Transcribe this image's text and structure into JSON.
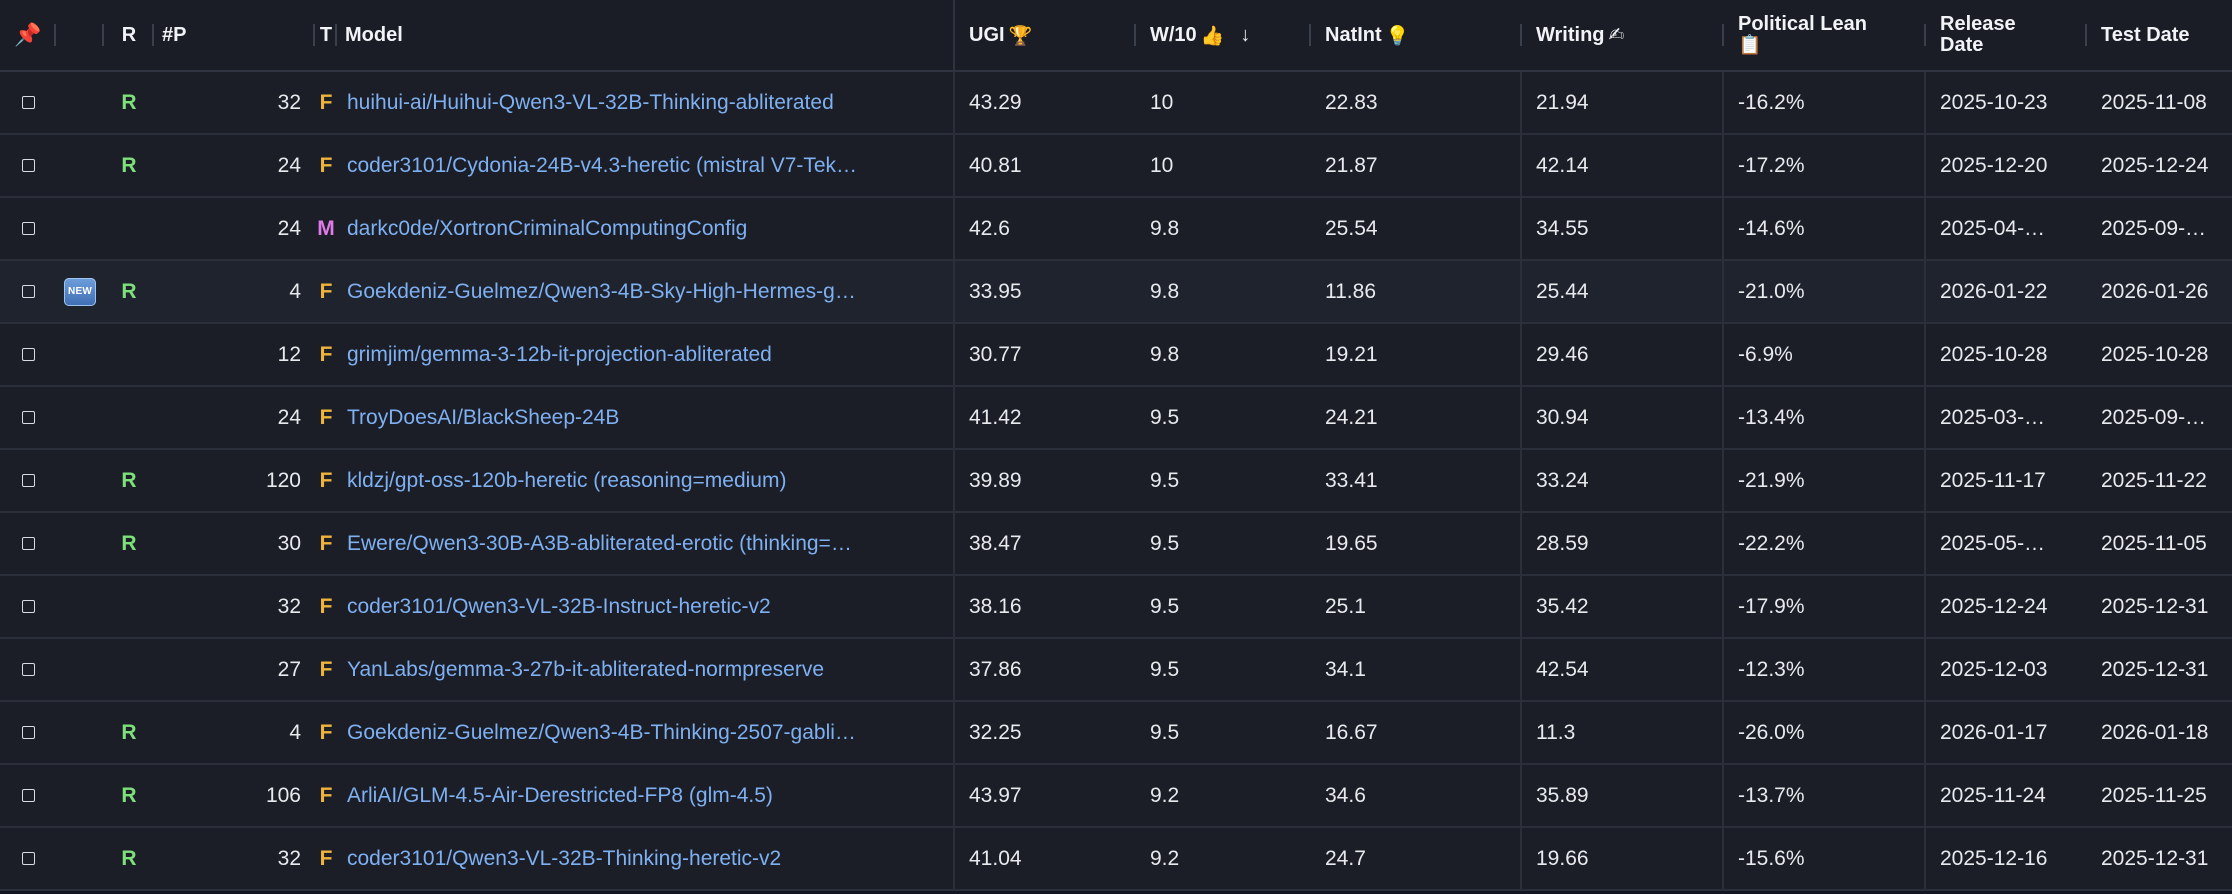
{
  "header": {
    "pin_icon": "pushpin-icon",
    "r": "R",
    "params": "#P",
    "type": "T",
    "model": "Model",
    "ugi": "UGI",
    "ugi_icon": "🏆",
    "w10": "W/10",
    "w10_icon": "👍",
    "w10_sort": "↓",
    "natint": "NatInt",
    "natint_icon": "💡",
    "writing": "Writing",
    "writing_icon": "✍",
    "political_line1": "Political Lean",
    "political_icon": "📋",
    "release_line1": "Release",
    "release_line2": "Date",
    "test_date": "Test Date"
  },
  "colors": {
    "background": "#131620",
    "row": "#1b1e27",
    "link": "#7eb0f2",
    "r_badge": "#7ee07a",
    "type_F": "#f0b43a",
    "type_M": "#e07ae8",
    "pin": "#e64848"
  },
  "rows": [
    {
      "new": "",
      "r": "R",
      "params": "32",
      "type": "F",
      "model": "huihui-ai/Huihui-Qwen3-VL-32B-Thinking-abliterated",
      "ugi": "43.29",
      "w10": "10",
      "natint": "22.83",
      "writing": "21.94",
      "political": "-16.2%",
      "release": "2025-10-23",
      "test": "2025-11-08"
    },
    {
      "new": "",
      "r": "R",
      "params": "24",
      "type": "F",
      "model": "coder3101/Cydonia-24B-v4.3-heretic (mistral V7-Tek…",
      "ugi": "40.81",
      "w10": "10",
      "natint": "21.87",
      "writing": "42.14",
      "political": "-17.2%",
      "release": "2025-12-20",
      "test": "2025-12-24"
    },
    {
      "new": "",
      "r": "",
      "params": "24",
      "type": "M",
      "model": "darkc0de/XortronCriminalComputingConfig",
      "ugi": "42.6",
      "w10": "9.8",
      "natint": "25.54",
      "writing": "34.55",
      "political": "-14.6%",
      "release": "2025-04-…",
      "test": "2025-09-…"
    },
    {
      "new": "NEW",
      "r": "R",
      "params": "4",
      "type": "F",
      "model": "Goekdeniz-Guelmez/Qwen3-4B-Sky-High-Hermes-g…",
      "ugi": "33.95",
      "w10": "9.8",
      "natint": "11.86",
      "writing": "25.44",
      "political": "-21.0%",
      "release": "2026-01-22",
      "test": "2026-01-26"
    },
    {
      "new": "",
      "r": "",
      "params": "12",
      "type": "F",
      "model": "grimjim/gemma-3-12b-it-projection-abliterated",
      "ugi": "30.77",
      "w10": "9.8",
      "natint": "19.21",
      "writing": "29.46",
      "political": "-6.9%",
      "release": "2025-10-28",
      "test": "2025-10-28"
    },
    {
      "new": "",
      "r": "",
      "params": "24",
      "type": "F",
      "model": "TroyDoesAI/BlackSheep-24B",
      "ugi": "41.42",
      "w10": "9.5",
      "natint": "24.21",
      "writing": "30.94",
      "political": "-13.4%",
      "release": "2025-03-…",
      "test": "2025-09-…"
    },
    {
      "new": "",
      "r": "R",
      "params": "120",
      "type": "F",
      "model": "kldzj/gpt-oss-120b-heretic (reasoning=medium)",
      "ugi": "39.89",
      "w10": "9.5",
      "natint": "33.41",
      "writing": "33.24",
      "political": "-21.9%",
      "release": "2025-11-17",
      "test": "2025-11-22"
    },
    {
      "new": "",
      "r": "R",
      "params": "30",
      "type": "F",
      "model": "Ewere/Qwen3-30B-A3B-abliterated-erotic (thinking=…",
      "ugi": "38.47",
      "w10": "9.5",
      "natint": "19.65",
      "writing": "28.59",
      "political": "-22.2%",
      "release": "2025-05-…",
      "test": "2025-11-05"
    },
    {
      "new": "",
      "r": "",
      "params": "32",
      "type": "F",
      "model": "coder3101/Qwen3-VL-32B-Instruct-heretic-v2",
      "ugi": "38.16",
      "w10": "9.5",
      "natint": "25.1",
      "writing": "35.42",
      "political": "-17.9%",
      "release": "2025-12-24",
      "test": "2025-12-31"
    },
    {
      "new": "",
      "r": "",
      "params": "27",
      "type": "F",
      "model": "YanLabs/gemma-3-27b-it-abliterated-normpreserve",
      "ugi": "37.86",
      "w10": "9.5",
      "natint": "34.1",
      "writing": "42.54",
      "political": "-12.3%",
      "release": "2025-12-03",
      "test": "2025-12-31"
    },
    {
      "new": "",
      "r": "R",
      "params": "4",
      "type": "F",
      "model": "Goekdeniz-Guelmez/Qwen3-4B-Thinking-2507-gabli…",
      "ugi": "32.25",
      "w10": "9.5",
      "natint": "16.67",
      "writing": "11.3",
      "political": "-26.0%",
      "release": "2026-01-17",
      "test": "2026-01-18"
    },
    {
      "new": "",
      "r": "R",
      "params": "106",
      "type": "F",
      "model": "ArliAI/GLM-4.5-Air-Derestricted-FP8 (glm-4.5)",
      "ugi": "43.97",
      "w10": "9.2",
      "natint": "34.6",
      "writing": "35.89",
      "political": "-13.7%",
      "release": "2025-11-24",
      "test": "2025-11-25"
    },
    {
      "new": "",
      "r": "R",
      "params": "32",
      "type": "F",
      "model": "coder3101/Qwen3-VL-32B-Thinking-heretic-v2",
      "ugi": "41.04",
      "w10": "9.2",
      "natint": "24.7",
      "writing": "19.66",
      "political": "-15.6%",
      "release": "2025-12-16",
      "test": "2025-12-31"
    }
  ]
}
